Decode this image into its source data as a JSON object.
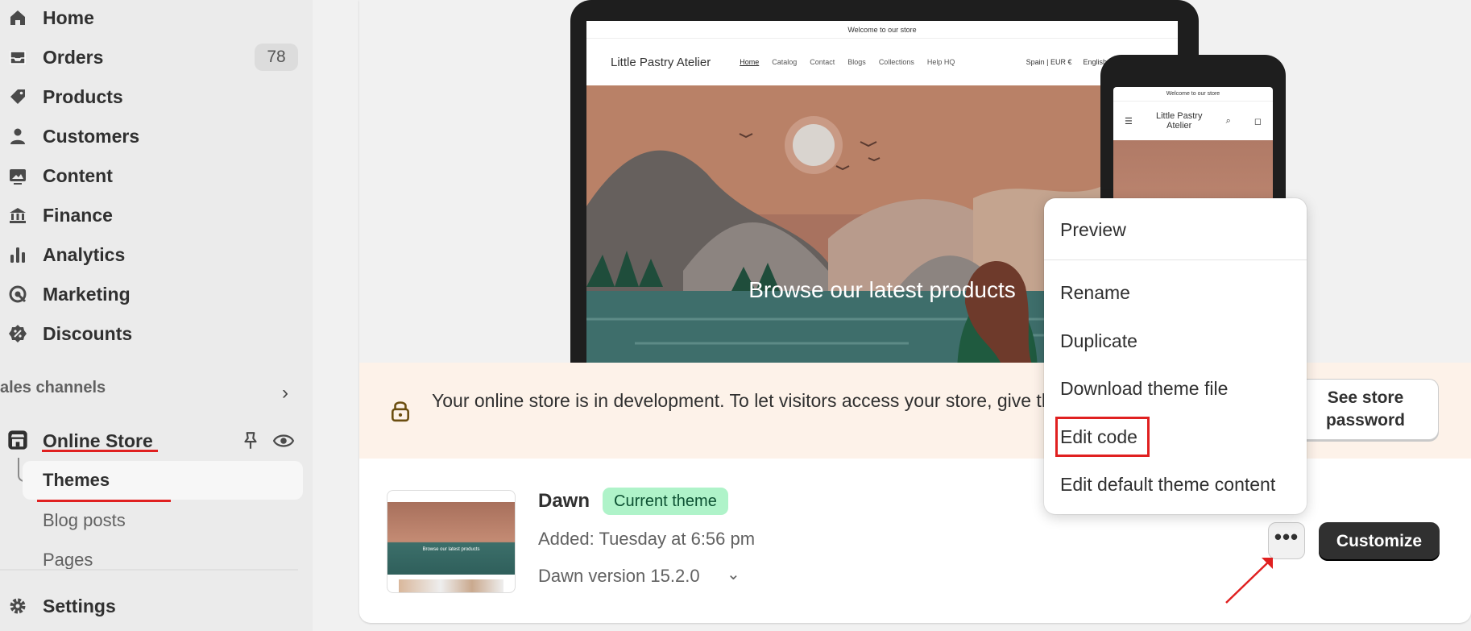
{
  "sidebar": {
    "items": [
      {
        "label": "Home",
        "icon": "home-icon"
      },
      {
        "label": "Orders",
        "icon": "inbox-icon",
        "badge": "78"
      },
      {
        "label": "Products",
        "icon": "tag-icon"
      },
      {
        "label": "Customers",
        "icon": "person-icon"
      },
      {
        "label": "Content",
        "icon": "image-icon"
      },
      {
        "label": "Finance",
        "icon": "bank-icon"
      },
      {
        "label": "Analytics",
        "icon": "bar-chart-icon"
      },
      {
        "label": "Marketing",
        "icon": "target-icon"
      },
      {
        "label": "Discounts",
        "icon": "discount-icon"
      }
    ],
    "sales_channels_label": "ales channels",
    "online_store_label": "Online Store",
    "sub_items": [
      "Themes",
      "Blog posts",
      "Pages"
    ],
    "settings_label": "Settings"
  },
  "preview": {
    "announcement": "Welcome to our store",
    "store_name": "Little Pastry Atelier",
    "nav": [
      "Home",
      "Catalog",
      "Contact",
      "Blogs",
      "Collections",
      "Help HQ"
    ],
    "region": "Spain | EUR €",
    "language": "English",
    "hero_text": "Browse our latest products",
    "phone_store_name_line1": "Little Pastry",
    "phone_store_name_line2": "Atelier"
  },
  "banner": {
    "text": "Your online store is in development. To let visitors access your store, give them the password.",
    "button_label_line1": "See store",
    "button_label_line2": "password"
  },
  "theme": {
    "name": "Dawn",
    "badge": "Current theme",
    "added": "Added: Tuesday at 6:56 pm",
    "version": "Dawn version 15.2.0",
    "thumb_text": "Browse our latest products",
    "more_label": "•••",
    "customize_label": "Customize"
  },
  "menu": {
    "items": [
      "Preview",
      "Rename",
      "Duplicate",
      "Download theme file",
      "Edit code",
      "Edit default theme content"
    ]
  },
  "colors": {
    "annotation": "#e02020",
    "badge_green": "#aff3c9",
    "banner_bg": "#fdf2e9",
    "primary_button": "#303030"
  }
}
